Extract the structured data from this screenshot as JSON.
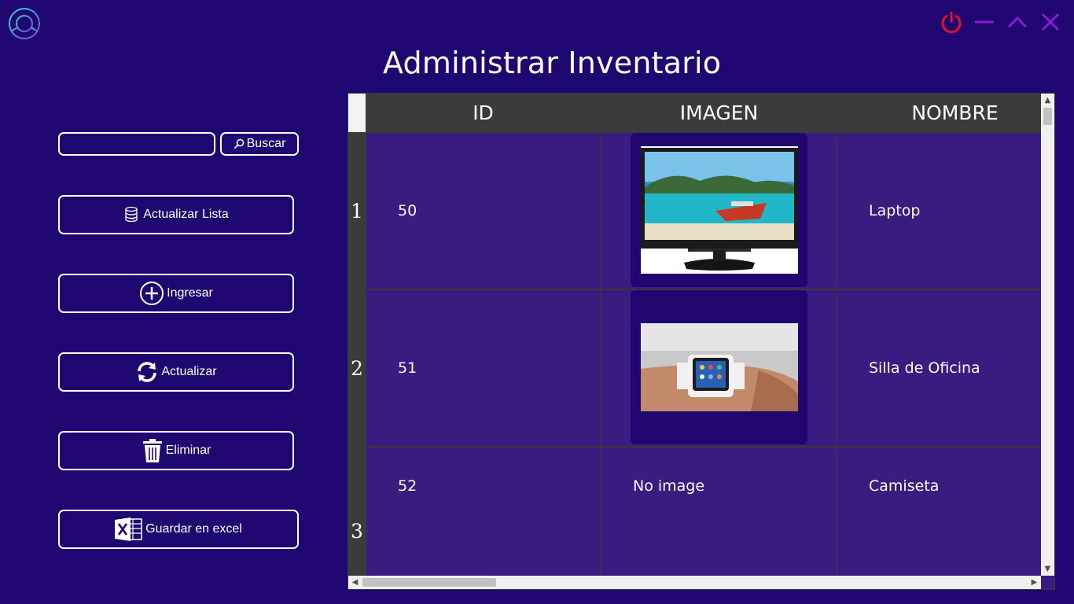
{
  "window": {
    "title": "Administrar Inventario",
    "controls": [
      "power-icon",
      "minimize-icon",
      "maximize-icon",
      "close-icon"
    ]
  },
  "search": {
    "value": "",
    "placeholder": "",
    "button_label": "Buscar"
  },
  "sidebar": {
    "buttons": [
      {
        "label": "Actualizar Lista",
        "icon": "database-list-icon"
      },
      {
        "label": "Ingresar",
        "icon": "plus-circle-icon"
      },
      {
        "label": "Actualizar",
        "icon": "refresh-icon"
      },
      {
        "label": "Eliminar",
        "icon": "trash-icon"
      },
      {
        "label": "Guardar en  excel",
        "icon": "excel-icon"
      }
    ]
  },
  "table": {
    "columns": [
      "ID",
      "IMAGEN",
      "NOMBRE"
    ],
    "rows": [
      {
        "num": "1",
        "id": "50",
        "image": "monitor-photo",
        "nombre": "Laptop"
      },
      {
        "num": "2",
        "id": "51",
        "image": "smartwatch-photo",
        "nombre": "Silla de Oficina"
      },
      {
        "num": "3",
        "id": "52",
        "image_text": "No image",
        "nombre": "Camiseta"
      }
    ]
  },
  "colors": {
    "background": "#1f0670",
    "cell": "#3a1c80",
    "header": "#3b3b3b",
    "power": "#e0142b",
    "controls": "#8a1bd6"
  }
}
